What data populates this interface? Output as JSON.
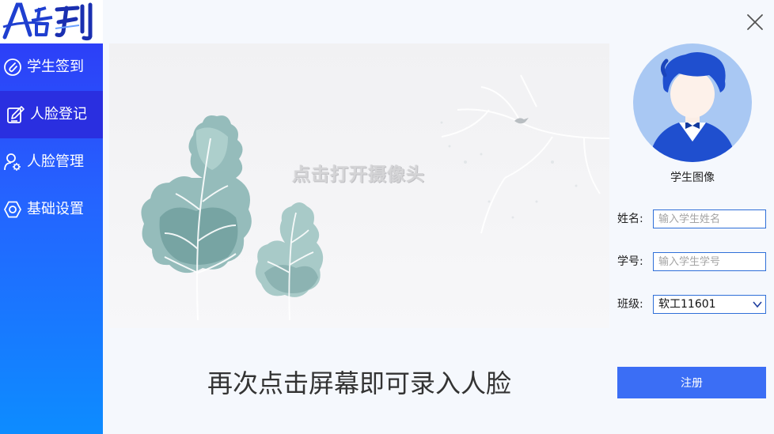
{
  "logo": {
    "text": "签到",
    "letter": "A"
  },
  "sidebar": {
    "items": [
      {
        "label": "学生签到",
        "icon": "clip-icon"
      },
      {
        "label": "人脸登记",
        "icon": "edit-icon",
        "active": true
      },
      {
        "label": "人脸管理",
        "icon": "user-gear-icon"
      },
      {
        "label": "基础设置",
        "icon": "hexagon-icon"
      }
    ]
  },
  "camera": {
    "prompt": "点击打开摄像头",
    "capture_hint": "再次点击屏幕即可录入人脸"
  },
  "avatar": {
    "caption": "学生图像"
  },
  "form": {
    "name_label": "姓名:",
    "name_placeholder": "输入学生姓名",
    "id_label": "学号:",
    "id_placeholder": "输入学生学号",
    "class_label": "班级:",
    "class_value": "软工11601",
    "register_label": "注册"
  },
  "colors": {
    "sidebar_top": "#2f35f5",
    "sidebar_bottom": "#0d8cff",
    "active_item": "#2a2fe0",
    "button": "#3b6ef5",
    "input_border": "#2f6fd8"
  }
}
